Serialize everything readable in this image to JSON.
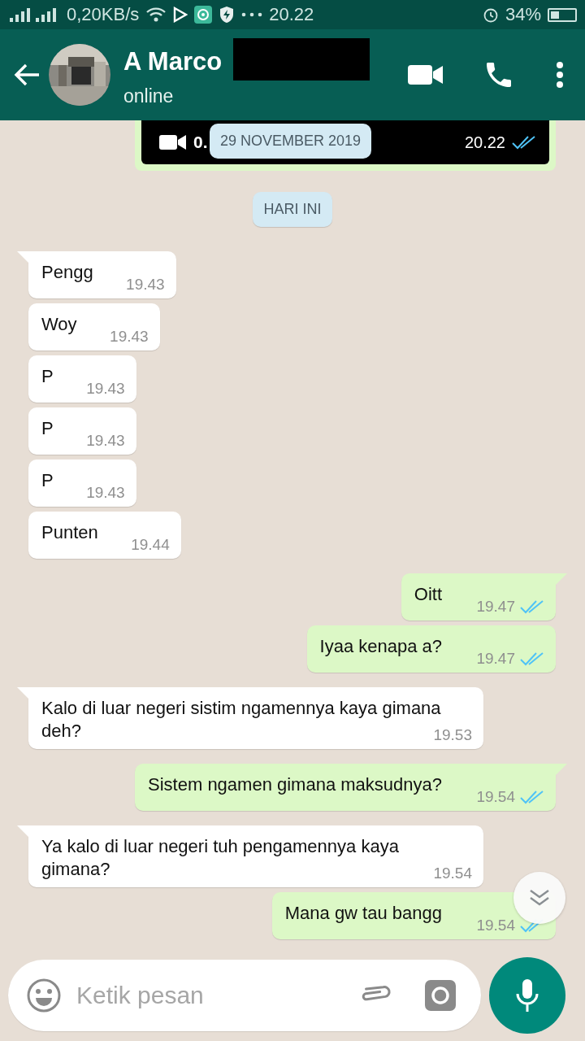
{
  "status_bar": {
    "speed": "0,20KB/s",
    "time": "20.22",
    "battery_text": "34%"
  },
  "header": {
    "name": "A Marco",
    "status": "online",
    "redacted": true
  },
  "video_message": {
    "duration": "0.",
    "time": "20.22",
    "read": true
  },
  "date_chips": [
    "29 NOVEMBER 2019",
    "HARI INI"
  ],
  "messages": [
    {
      "kind": "incoming",
      "tail": true,
      "text": "Pengg",
      "time": "19.43"
    },
    {
      "kind": "incoming",
      "tail": false,
      "text": "Woy",
      "time": "19.43"
    },
    {
      "kind": "incoming",
      "tail": false,
      "text": "P",
      "time": "19.43"
    },
    {
      "kind": "incoming",
      "tail": false,
      "text": "P",
      "time": "19.43"
    },
    {
      "kind": "incoming",
      "tail": false,
      "text": "P",
      "time": "19.43"
    },
    {
      "kind": "incoming",
      "tail": false,
      "text": "Punten",
      "time": "19.44"
    },
    {
      "kind": "outgoing",
      "tail": true,
      "text": "Oitt",
      "time": "19.47",
      "read": true
    },
    {
      "kind": "outgoing",
      "tail": false,
      "text": "Iyaa kenapa a?",
      "time": "19.47",
      "read": true
    },
    {
      "kind": "incoming",
      "tail": true,
      "text": "Kalo di luar negeri sistim ngamennya kaya gimana deh?",
      "time": "19.53"
    },
    {
      "kind": "outgoing",
      "tail": true,
      "text": "Sistem ngamen gimana maksudnya?",
      "time": "19.54",
      "read": true
    },
    {
      "kind": "incoming",
      "tail": true,
      "text": "Ya kalo di luar negeri tuh pengamennya kaya gimana?",
      "time": "19.54"
    },
    {
      "kind": "outgoing",
      "tail": false,
      "text": "Mana gw tau bangg",
      "time": "19.54",
      "read": true
    }
  ],
  "composer": {
    "placeholder": "Ketik pesan"
  }
}
